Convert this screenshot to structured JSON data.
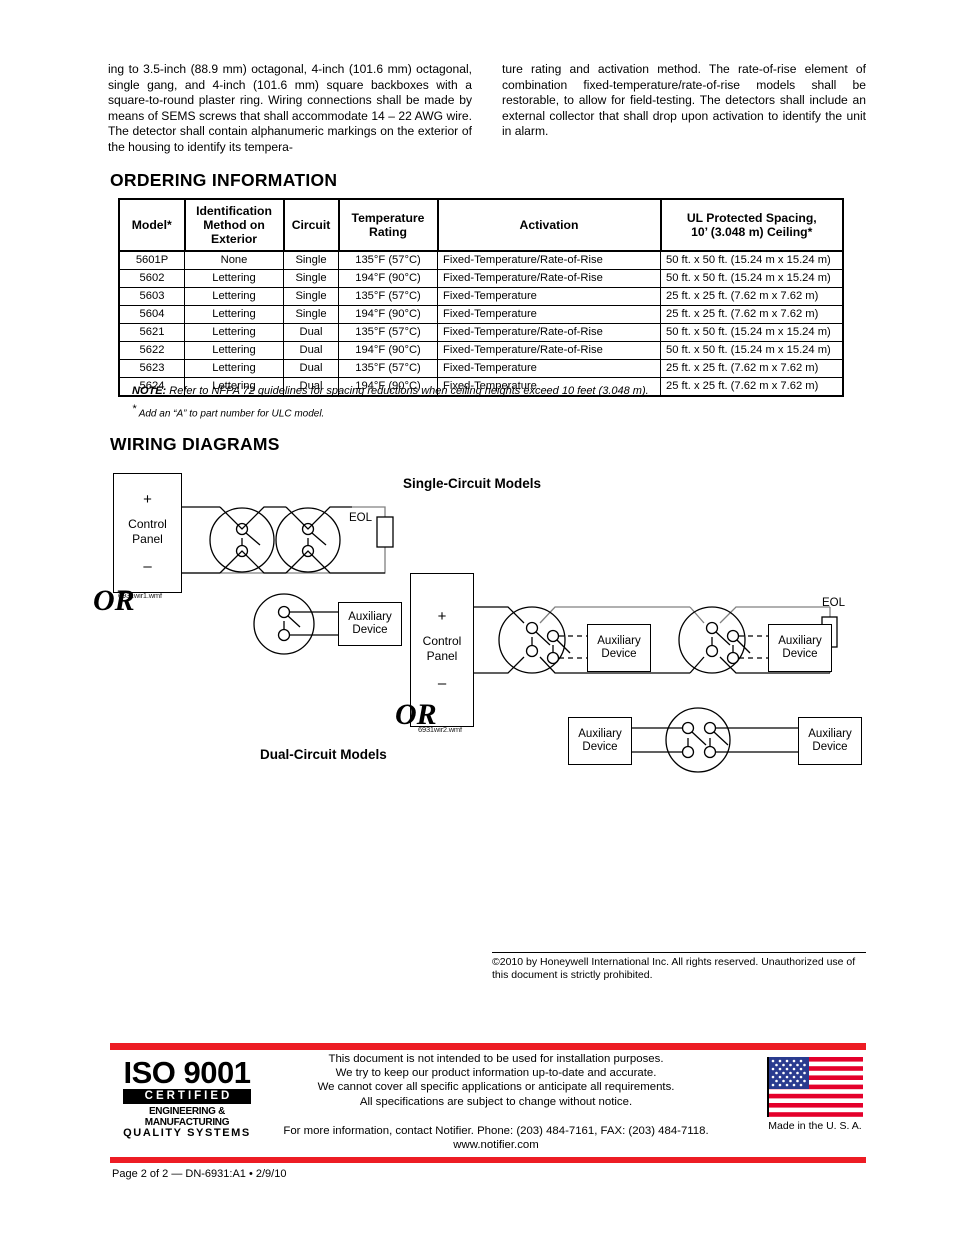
{
  "body_text": {
    "left_column": "ing to 3.5-inch (88.9 mm) octagonal, 4-inch (101.6 mm) octagonal, single gang, and 4-inch (101.6 mm) square backboxes with a square-to-round plaster ring. Wiring connections shall be made by means of SEMS screws that shall accommodate 14 – 22 AWG wire. The detector shall contain alphanumeric markings on the exterior of the housing to identify its tempera-",
    "right_column": "ture rating and activation method. The rate-of-rise element of combination fixed-temperature/rate-of-rise models shall be restorable, to allow for field-testing. The detectors shall include an external collector that shall drop upon activation to identify the unit in alarm."
  },
  "headings": {
    "ordering": "ORDERING INFORMATION",
    "wiring": "WIRING DIAGRAMS"
  },
  "ordering_table": {
    "columns": [
      "Model*",
      "Identification Method on Exterior",
      "Circuit",
      "Temperature Rating",
      "Activation",
      "UL Protected Spacing, 10’ (3.048 m) Ceiling*"
    ],
    "columns_multiline": {
      "model": "Model*",
      "identification_l1": "Identification",
      "identification_l2": "Method on",
      "identification_l3": "Exterior",
      "circuit": "Circuit",
      "temperature_l1": "Temperature",
      "temperature_l2": "Rating",
      "activation": "Activation",
      "spacing_l1": "UL Protected Spacing,",
      "spacing_l2": "10’ (3.048 m) Ceiling*"
    },
    "rows": [
      {
        "model": "5601P",
        "identification": "None",
        "circuit": "Single",
        "temperature": "135°F (57°C)",
        "activation": "Fixed-Temperature/Rate-of-Rise",
        "spacing": "50 ft. x 50 ft. (15.24 m x 15.24 m)"
      },
      {
        "model": "5602",
        "identification": "Lettering",
        "circuit": "Single",
        "temperature": "194°F (90°C)",
        "activation": "Fixed-Temperature/Rate-of-Rise",
        "spacing": "50 ft. x 50 ft. (15.24 m x 15.24 m)"
      },
      {
        "model": "5603",
        "identification": "Lettering",
        "circuit": "Single",
        "temperature": "135°F (57°C)",
        "activation": "Fixed-Temperature",
        "spacing": "25 ft. x 25 ft. (7.62 m x 7.62 m)"
      },
      {
        "model": "5604",
        "identification": "Lettering",
        "circuit": "Single",
        "temperature": "194°F (90°C)",
        "activation": "Fixed-Temperature",
        "spacing": "25 ft. x 25 ft. (7.62 m x 7.62 m)"
      },
      {
        "model": "5621",
        "identification": "Lettering",
        "circuit": "Dual",
        "temperature": "135°F (57°C)",
        "activation": "Fixed-Temperature/Rate-of-Rise",
        "spacing": "50 ft. x 50 ft. (15.24 m x 15.24 m)"
      },
      {
        "model": "5622",
        "identification": "Lettering",
        "circuit": "Dual",
        "temperature": "194°F (90°C)",
        "activation": "Fixed-Temperature/Rate-of-Rise",
        "spacing": "50 ft. x 50 ft. (15.24 m x 15.24 m)"
      },
      {
        "model": "5623",
        "identification": "Lettering",
        "circuit": "Dual",
        "temperature": "135°F (57°C)",
        "activation": "Fixed-Temperature",
        "spacing": "25 ft. x 25 ft. (7.62 m x 7.62 m)"
      },
      {
        "model": "5624",
        "identification": "Lettering",
        "circuit": "Dual",
        "temperature": "194°F (90°C)",
        "activation": "Fixed-Temperature",
        "spacing": "25 ft. x 25 ft. (7.62 m x 7.62 m)"
      }
    ]
  },
  "notes": {
    "note_label": "NOTE:",
    "note_body": " Refer to NFPA 72 guidelines for spacing reductions when ceiling heights exceed 10 feet (3.048 m).",
    "footnote_star": "*",
    "footnote_body": " Add an “A” to part number for ULC model."
  },
  "wiring": {
    "single_title": "Single-Circuit Models",
    "dual_title": "Dual-Circuit Models",
    "or_1": "OR",
    "or_2": "OR",
    "wmf_1": "6931wir1.wmf",
    "wmf_2": "6931wir2.wmf",
    "control_panel": {
      "plus": "+",
      "name_l1": "Control",
      "name_l2": "Panel",
      "minus": "–"
    },
    "eol_label": "EOL",
    "aux_device": {
      "line1": "Auxiliary",
      "line2": "Device"
    }
  },
  "copyright": "©2010 by Honeywell International Inc. All rights reserved. Unauthorized use of this document is strictly prohibited.",
  "footer": {
    "iso": {
      "main": "ISO 9001",
      "certified": "CERTIFIED",
      "sub1": "ENGINEERING & MANUFACTURING",
      "sub2": "QUALITY SYSTEMS"
    },
    "disclaimer_lines": [
      "This document is not intended to be used for installation purposes.",
      "We try to keep our product information up-to-date and accurate.",
      "We cannot cover all specific applications or anticipate all requirements.",
      "All specifications are subject to change without notice."
    ],
    "contact_line": "For more information, contact Notifier. Phone: (203) 484-7161, FAX: (203) 484-7118.",
    "website": "www.notifier.com",
    "made_in": "Made in the U. S. A.",
    "page_line": "Page 2 of 2 — DN-6931:A1 • 2/9/10",
    "accent_color": "#ed1c24"
  }
}
